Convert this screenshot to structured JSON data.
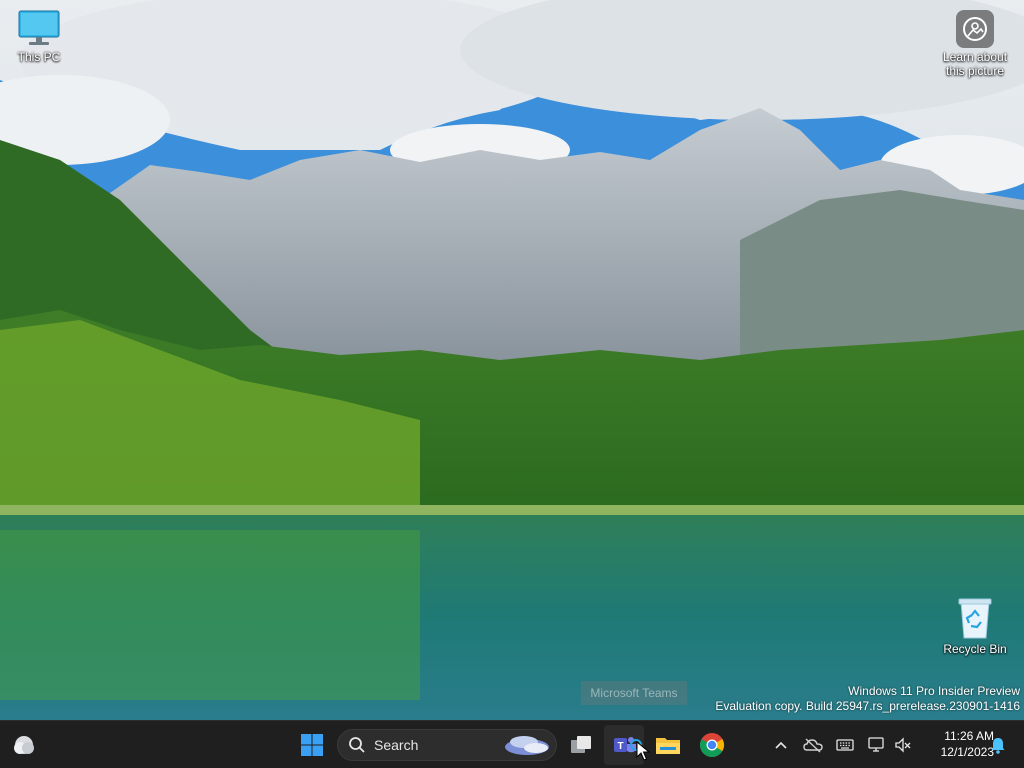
{
  "desktop": {
    "icons": [
      {
        "label": "This PC"
      },
      {
        "label": "Recycle Bin"
      }
    ],
    "learn_about": {
      "label_line1": "Learn about",
      "label_line2": "this picture"
    },
    "watermark": {
      "line1": "Windows 11 Pro Insider Preview",
      "line2": "Evaluation copy. Build 25947.rs_prerelease.230901-1416"
    },
    "tooltip": "Microsoft Teams"
  },
  "taskbar": {
    "search_label": "Search",
    "pinned": [
      {
        "icon": "teams-icon"
      },
      {
        "icon": "file-explorer-icon"
      },
      {
        "icon": "chrome-icon"
      }
    ],
    "tray": {
      "icons": [
        "chevron-up-icon",
        "onedrive-icon",
        "keyboard-icon",
        "network-icon",
        "volume-muted-icon"
      ]
    },
    "clock": {
      "time": "11:26 AM",
      "date": "12/1/2023"
    }
  },
  "colors": {
    "taskbar_bg": "#1f1f1f",
    "start_blue": "#3aa0f3",
    "notif_blue": "#4cc2ff"
  }
}
